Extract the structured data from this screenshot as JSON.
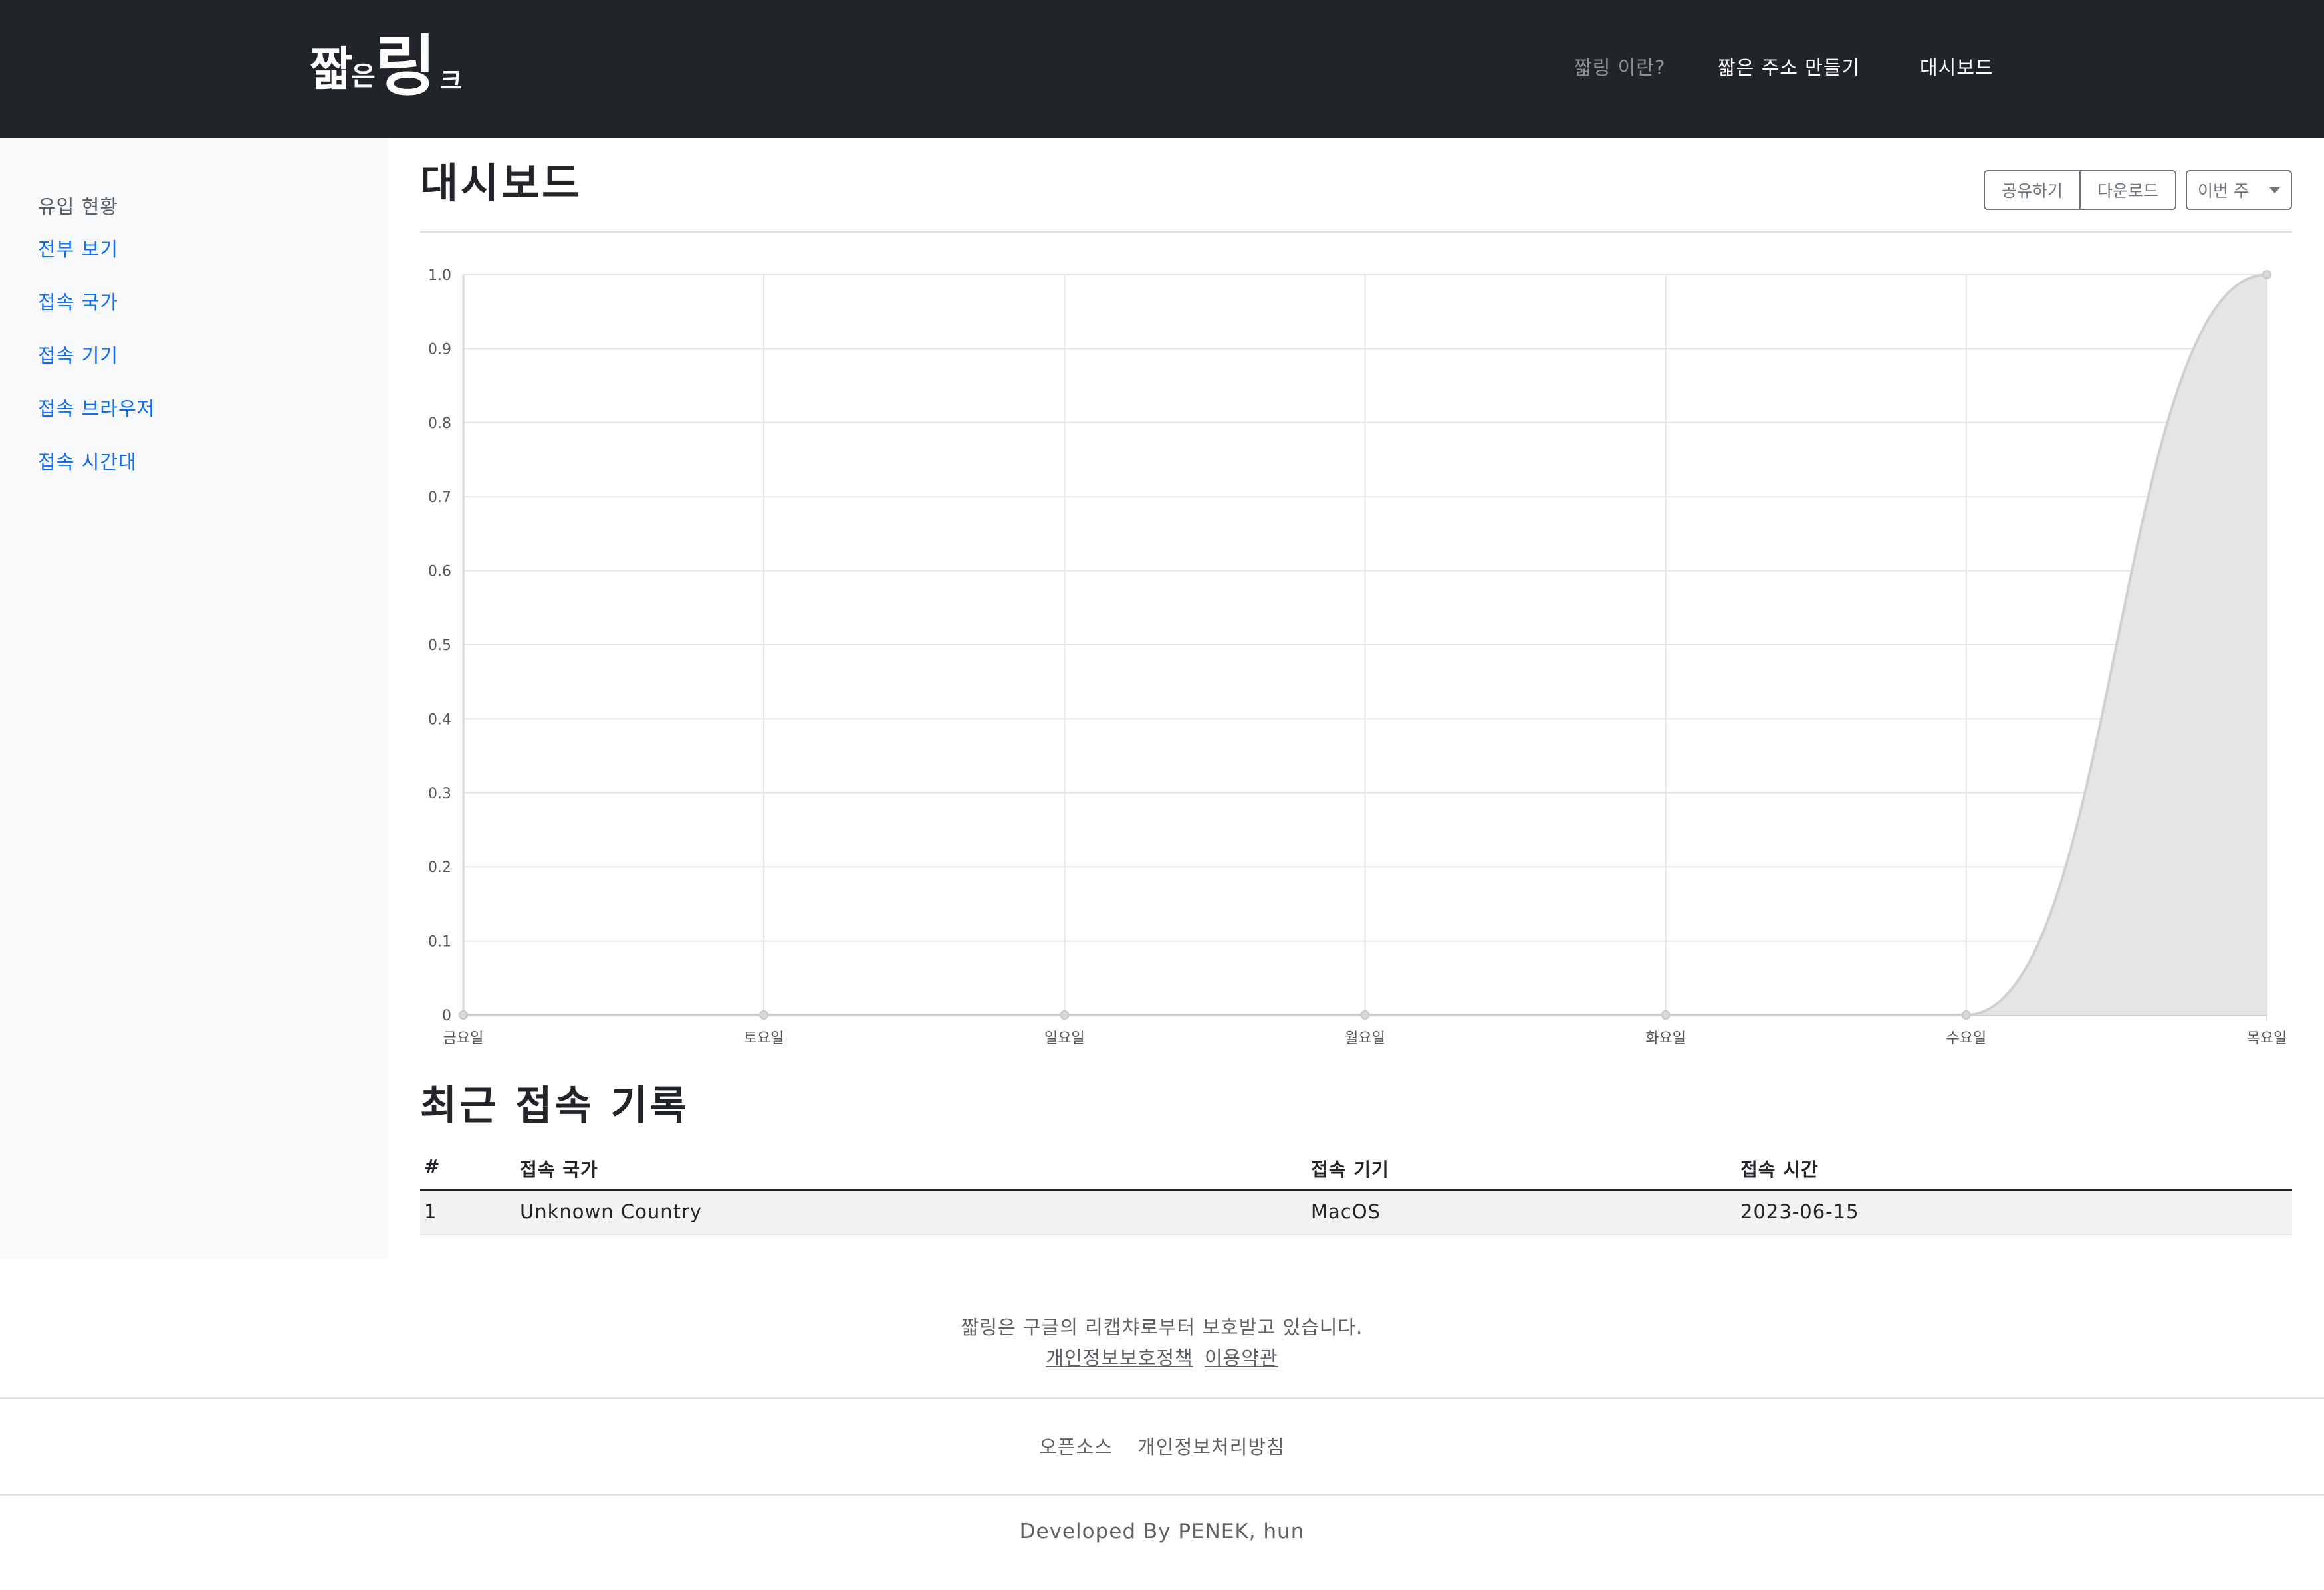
{
  "navbar": {
    "logo_text": "짧은링크",
    "links": [
      {
        "label": "짧링 이란?"
      },
      {
        "label": "짧은 주소 만들기"
      },
      {
        "label": "대시보드"
      }
    ]
  },
  "sidebar": {
    "heading": "유입 현황",
    "items": [
      {
        "label": "전부 보기"
      },
      {
        "label": "접속 국가"
      },
      {
        "label": "접속 기기"
      },
      {
        "label": "접속 브라우저"
      },
      {
        "label": "접속 시간대"
      }
    ]
  },
  "main": {
    "title": "대시보드",
    "buttons": {
      "share": "공유하기",
      "download": "다운로드",
      "period": "이번 주"
    }
  },
  "chart_data": {
    "type": "area",
    "categories": [
      "금요일",
      "토요일",
      "일요일",
      "월요일",
      "화요일",
      "수요일",
      "목요일"
    ],
    "values": [
      0,
      0,
      0,
      0,
      0,
      0,
      1
    ],
    "ylim": [
      0,
      1
    ],
    "yticks": [
      "0",
      "0.1",
      "0.2",
      "0.3",
      "0.4",
      "0.5",
      "0.6",
      "0.7",
      "0.8",
      "0.9",
      "1.0"
    ],
    "grid": true,
    "fill_color": "#e5e5e5",
    "line_color": "#d0d0d0"
  },
  "recent": {
    "title": "최근 접속 기록",
    "columns": [
      "#",
      "접속 국가",
      "접속 기기",
      "접속 시간"
    ],
    "rows": [
      [
        "1",
        "Unknown Country",
        "MacOS",
        "2023-06-15"
      ]
    ]
  },
  "footer": {
    "note": "짧링은 구글의 리캡챠로부터 보호받고 있습니다.",
    "privacy_link": "개인정보보호정책",
    "terms_link": "이용약관",
    "nav": [
      "오픈소스",
      "개인정보처리방침"
    ],
    "developed": "Developed By PENEK, hun"
  },
  "colors": {
    "navbar_bg": "#212529",
    "sidebar_bg": "#f8f9fa",
    "link": "#0d6efd"
  }
}
